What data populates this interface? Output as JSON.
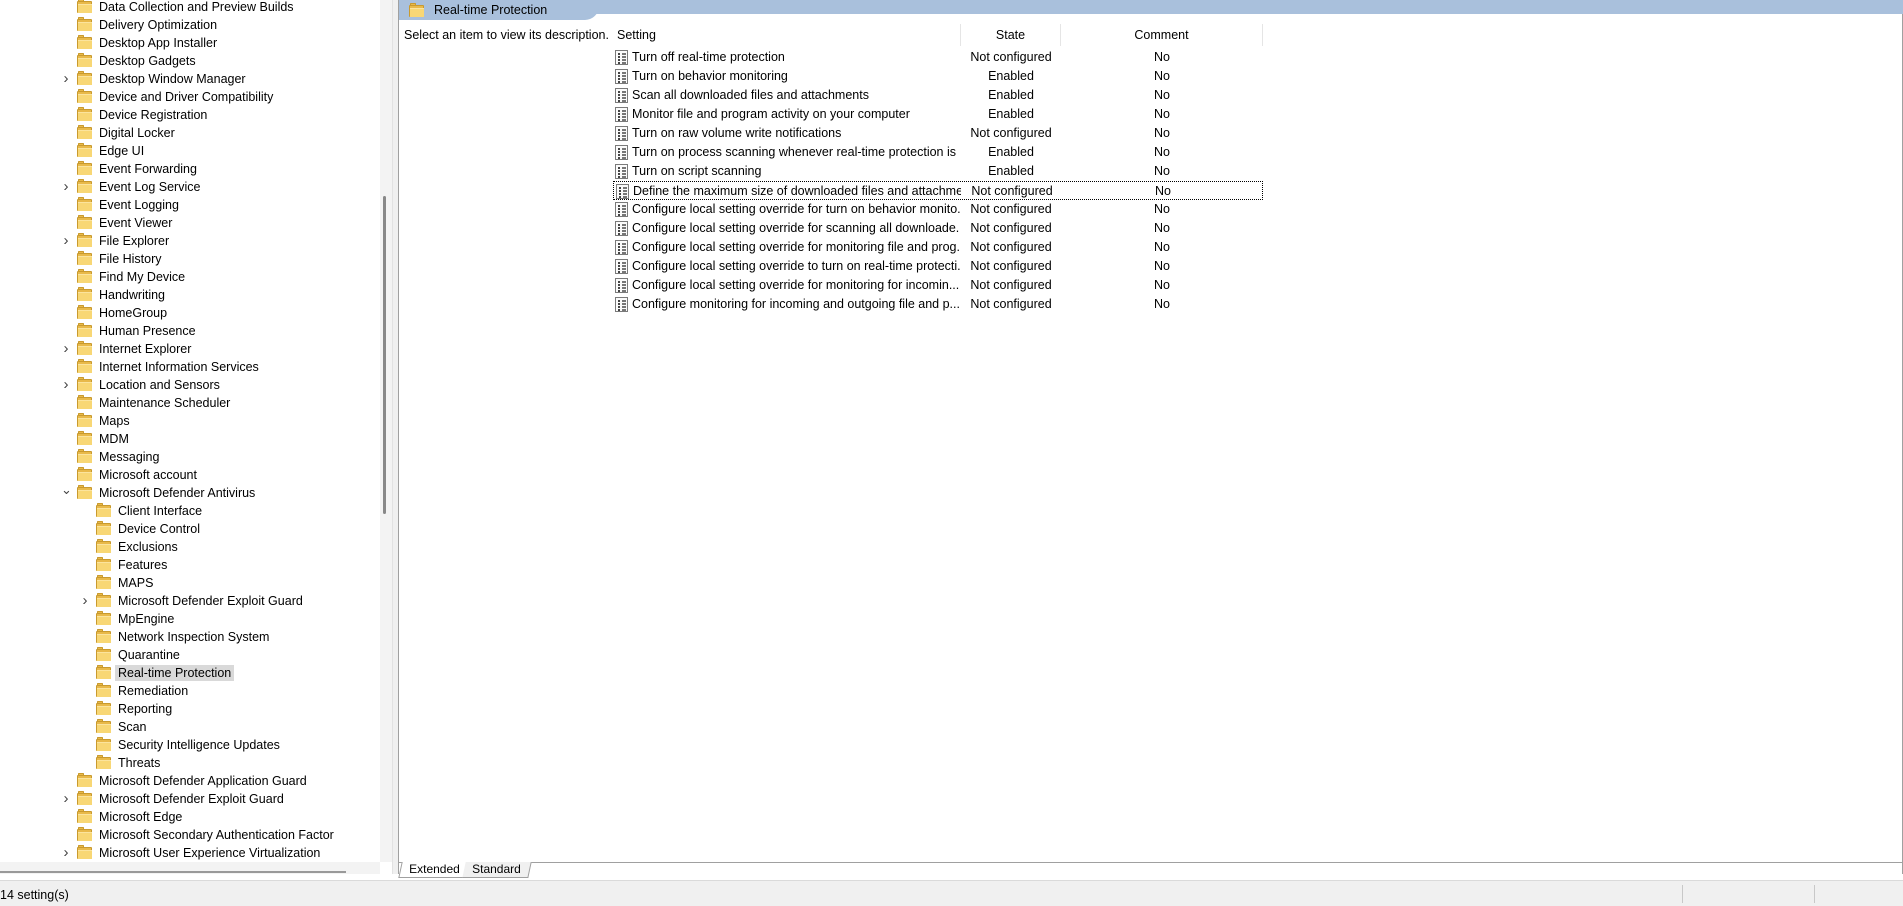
{
  "tree": {
    "items": [
      {
        "label": "Data Collection and Preview Builds",
        "level": 1,
        "expand": "none"
      },
      {
        "label": "Delivery Optimization",
        "level": 1,
        "expand": "none"
      },
      {
        "label": "Desktop App Installer",
        "level": 1,
        "expand": "none"
      },
      {
        "label": "Desktop Gadgets",
        "level": 1,
        "expand": "none"
      },
      {
        "label": "Desktop Window Manager",
        "level": 1,
        "expand": "collapsed"
      },
      {
        "label": "Device and Driver Compatibility",
        "level": 1,
        "expand": "none"
      },
      {
        "label": "Device Registration",
        "level": 1,
        "expand": "none"
      },
      {
        "label": "Digital Locker",
        "level": 1,
        "expand": "none"
      },
      {
        "label": "Edge UI",
        "level": 1,
        "expand": "none"
      },
      {
        "label": "Event Forwarding",
        "level": 1,
        "expand": "none"
      },
      {
        "label": "Event Log Service",
        "level": 1,
        "expand": "collapsed"
      },
      {
        "label": "Event Logging",
        "level": 1,
        "expand": "none"
      },
      {
        "label": "Event Viewer",
        "level": 1,
        "expand": "none"
      },
      {
        "label": "File Explorer",
        "level": 1,
        "expand": "collapsed"
      },
      {
        "label": "File History",
        "level": 1,
        "expand": "none"
      },
      {
        "label": "Find My Device",
        "level": 1,
        "expand": "none"
      },
      {
        "label": "Handwriting",
        "level": 1,
        "expand": "none"
      },
      {
        "label": "HomeGroup",
        "level": 1,
        "expand": "none"
      },
      {
        "label": "Human Presence",
        "level": 1,
        "expand": "none"
      },
      {
        "label": "Internet Explorer",
        "level": 1,
        "expand": "collapsed"
      },
      {
        "label": "Internet Information Services",
        "level": 1,
        "expand": "none"
      },
      {
        "label": "Location and Sensors",
        "level": 1,
        "expand": "collapsed"
      },
      {
        "label": "Maintenance Scheduler",
        "level": 1,
        "expand": "none"
      },
      {
        "label": "Maps",
        "level": 1,
        "expand": "none"
      },
      {
        "label": "MDM",
        "level": 1,
        "expand": "none"
      },
      {
        "label": "Messaging",
        "level": 1,
        "expand": "none"
      },
      {
        "label": "Microsoft account",
        "level": 1,
        "expand": "none"
      },
      {
        "label": "Microsoft Defender Antivirus",
        "level": 1,
        "expand": "expanded"
      },
      {
        "label": "Client Interface",
        "level": 2,
        "expand": "none"
      },
      {
        "label": "Device Control",
        "level": 2,
        "expand": "none"
      },
      {
        "label": "Exclusions",
        "level": 2,
        "expand": "none"
      },
      {
        "label": "Features",
        "level": 2,
        "expand": "none"
      },
      {
        "label": "MAPS",
        "level": 2,
        "expand": "none"
      },
      {
        "label": "Microsoft Defender Exploit Guard",
        "level": 2,
        "expand": "collapsed"
      },
      {
        "label": "MpEngine",
        "level": 2,
        "expand": "none"
      },
      {
        "label": "Network Inspection System",
        "level": 2,
        "expand": "none"
      },
      {
        "label": "Quarantine",
        "level": 2,
        "expand": "none"
      },
      {
        "label": "Real-time Protection",
        "level": 2,
        "expand": "none",
        "selected": true
      },
      {
        "label": "Remediation",
        "level": 2,
        "expand": "none"
      },
      {
        "label": "Reporting",
        "level": 2,
        "expand": "none"
      },
      {
        "label": "Scan",
        "level": 2,
        "expand": "none"
      },
      {
        "label": "Security Intelligence Updates",
        "level": 2,
        "expand": "none"
      },
      {
        "label": "Threats",
        "level": 2,
        "expand": "none"
      },
      {
        "label": "Microsoft Defender Application Guard",
        "level": 1,
        "expand": "none"
      },
      {
        "label": "Microsoft Defender Exploit Guard",
        "level": 1,
        "expand": "collapsed"
      },
      {
        "label": "Microsoft Edge",
        "level": 1,
        "expand": "none"
      },
      {
        "label": "Microsoft Secondary Authentication Factor",
        "level": 1,
        "expand": "none"
      },
      {
        "label": "Microsoft User Experience Virtualization",
        "level": 1,
        "expand": "collapsed"
      }
    ]
  },
  "header": {
    "title": "Real-time Protection"
  },
  "description": {
    "text": "Select an item to view its description."
  },
  "table": {
    "columns": {
      "setting": "Setting",
      "state": "State",
      "comment": "Comment"
    },
    "rows": [
      {
        "setting": "Turn off real-time protection",
        "state": "Not configured",
        "comment": "No"
      },
      {
        "setting": "Turn on behavior monitoring",
        "state": "Enabled",
        "comment": "No"
      },
      {
        "setting": "Scan all downloaded files and attachments",
        "state": "Enabled",
        "comment": "No"
      },
      {
        "setting": "Monitor file and program activity on your computer",
        "state": "Enabled",
        "comment": "No"
      },
      {
        "setting": "Turn on raw volume write notifications",
        "state": "Not configured",
        "comment": "No"
      },
      {
        "setting": "Turn on process scanning whenever real-time protection is ...",
        "state": "Enabled",
        "comment": "No"
      },
      {
        "setting": "Turn on script scanning",
        "state": "Enabled",
        "comment": "No"
      },
      {
        "setting": "Define the maximum size of downloaded files and attachme...",
        "state": "Not configured",
        "comment": "No",
        "focused": true
      },
      {
        "setting": "Configure local setting override for turn on behavior monito...",
        "state": "Not configured",
        "comment": "No"
      },
      {
        "setting": "Configure local setting override for scanning all downloade...",
        "state": "Not configured",
        "comment": "No"
      },
      {
        "setting": "Configure local setting override for monitoring file and prog...",
        "state": "Not configured",
        "comment": "No"
      },
      {
        "setting": "Configure local setting override to turn on real-time protecti...",
        "state": "Not configured",
        "comment": "No"
      },
      {
        "setting": "Configure local setting override for monitoring for incomin...",
        "state": "Not configured",
        "comment": "No"
      },
      {
        "setting": "Configure monitoring for incoming and outgoing file and p...",
        "state": "Not configured",
        "comment": "No"
      }
    ]
  },
  "tabs": [
    {
      "label": "Extended",
      "active": true
    },
    {
      "label": "Standard",
      "active": false
    }
  ],
  "status": {
    "text": "14 setting(s)"
  },
  "icons": {
    "folder": "folder-icon",
    "policy": "policy-setting-icon",
    "expand": "chevron-right-icon",
    "collapse": "chevron-down-icon"
  },
  "colors": {
    "header": "#a9c0dc",
    "selection": "#d9d9d9",
    "folder": "#f8d775"
  }
}
